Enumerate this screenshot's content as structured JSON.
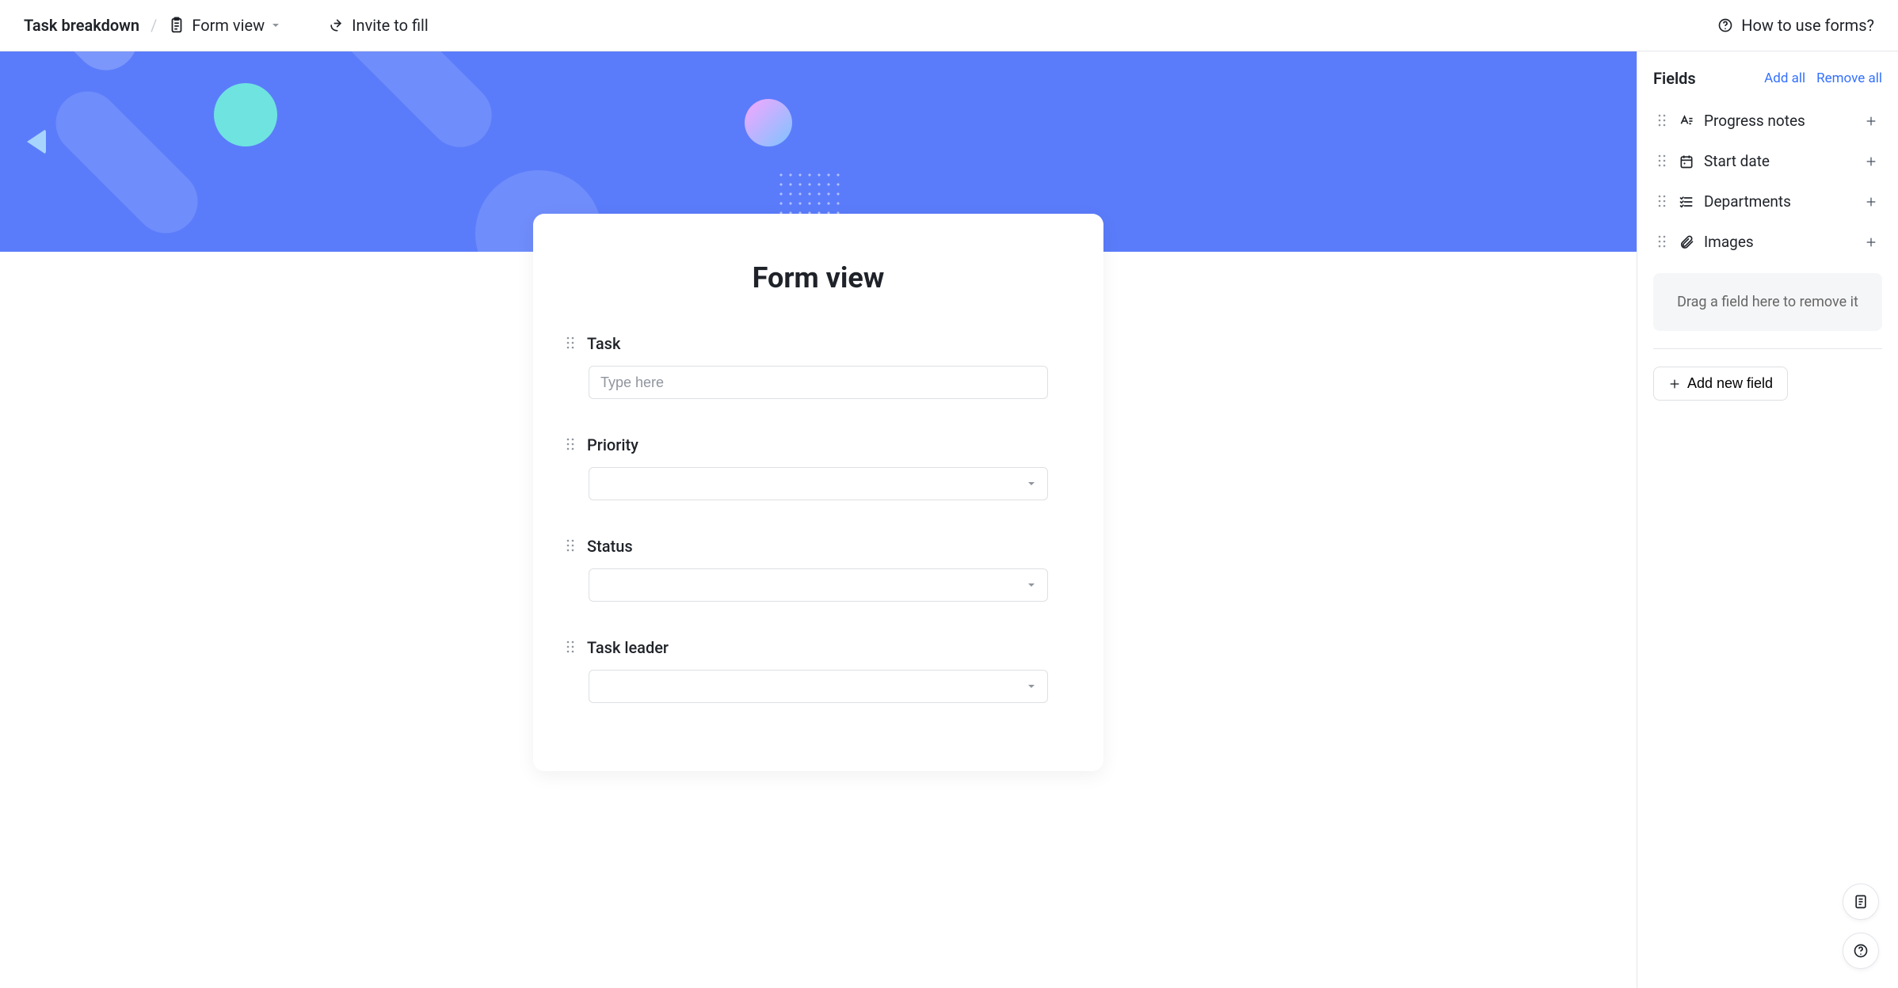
{
  "header": {
    "breadcrumb": "Task breakdown",
    "view_label": "Form view",
    "invite_label": "Invite to fill",
    "help_label": "How to use forms?"
  },
  "form": {
    "title": "Form view",
    "fields": [
      {
        "label": "Task",
        "type": "text",
        "placeholder": "Type here"
      },
      {
        "label": "Priority",
        "type": "select",
        "placeholder": ""
      },
      {
        "label": "Status",
        "type": "select",
        "placeholder": ""
      },
      {
        "label": "Task leader",
        "type": "select",
        "placeholder": ""
      }
    ]
  },
  "sidebar": {
    "title": "Fields",
    "add_all": "Add all",
    "remove_all": "Remove all",
    "available": [
      {
        "name": "Progress notes",
        "icon": "text"
      },
      {
        "name": "Start date",
        "icon": "date"
      },
      {
        "name": "Departments",
        "icon": "list"
      },
      {
        "name": "Images",
        "icon": "attachment"
      }
    ],
    "dropzone": "Drag a field here to remove it",
    "add_new": "Add new field"
  }
}
